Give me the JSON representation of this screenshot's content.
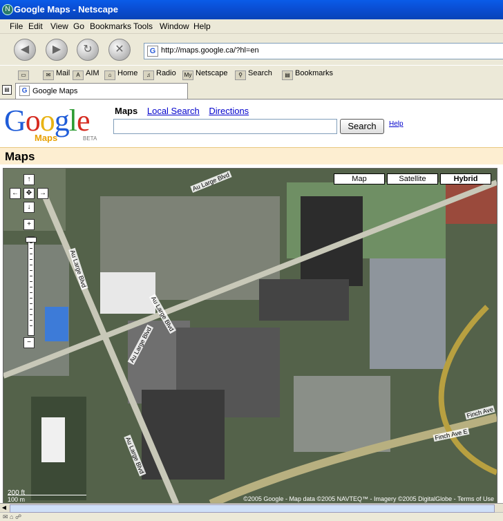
{
  "window": {
    "title": "Google Maps - Netscape"
  },
  "menu": [
    "File",
    "Edit",
    "View",
    "Go",
    "Bookmarks",
    "Tools",
    "Window",
    "Help"
  ],
  "nav": {
    "url": "http://maps.google.ca/?hl=en"
  },
  "bookmarks_bar": [
    "Mail",
    "AIM",
    "Home",
    "Radio",
    "Netscape",
    "Search",
    "Bookmarks"
  ],
  "tab": {
    "label": "Google Maps"
  },
  "page": {
    "logo_text": "Google",
    "logo_sub": "Maps",
    "logo_beta": "BETA",
    "links": [
      "Maps",
      "Local Search",
      "Directions"
    ],
    "search_value": "",
    "search_button": "Search",
    "help": "Help",
    "section_title": "Maps"
  },
  "map": {
    "types": [
      "Map",
      "Satellite",
      "Hybrid"
    ],
    "active_type": "Hybrid",
    "pan_controls": [
      "↑",
      "←",
      "✥",
      "→",
      "↓"
    ],
    "zoom_in": "+",
    "zoom_out": "−",
    "scale_upper": "200 ft",
    "scale_lower": "100 m",
    "copyright": "©2005 Google - Map data ©2005 NAVTEQ™ - Imagery ©2005 DigitalGlobe - Terms of Use",
    "road_labels": [
      "Au Large Blvd",
      "Au Large Blvd",
      "Au Large Blvd",
      "Au Large Blvd",
      "Au Large Blvd",
      "Finch Ave",
      "Finch Ave E"
    ]
  }
}
